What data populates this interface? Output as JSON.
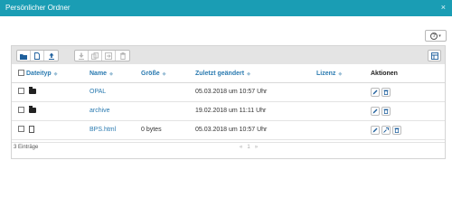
{
  "window": {
    "title": "Persönlicher Ordner",
    "close_glyph": "×"
  },
  "help": {
    "icon": "question-circle-icon",
    "caret": "▾"
  },
  "toolbar": {
    "left_group": [
      "folder-new-icon",
      "file-new-icon",
      "upload-icon"
    ],
    "middle_group": [
      "download-icon",
      "copy-icon",
      "move-icon",
      "delete-icon"
    ],
    "right_button": "settings-table-icon"
  },
  "table": {
    "columns": {
      "type": "Dateityp",
      "name": "Name",
      "size": "Größe",
      "modified": "Zuletzt geändert",
      "license": "Lizenz",
      "actions": "Aktionen"
    },
    "sort_glyph": "◆",
    "rows": [
      {
        "type": "folder",
        "name": "OPAL",
        "size": "",
        "modified": "05.03.2018 um 10:57 Uhr"
      },
      {
        "type": "folder",
        "name": "archive",
        "size": "",
        "modified": "19.02.2018 um 11:11 Uhr"
      },
      {
        "type": "file",
        "name": "BPS.html",
        "size": "0 bytes",
        "modified": "05.03.2018 um 10:57 Uhr"
      }
    ]
  },
  "footer": {
    "count": "3 Einträge",
    "prev": "«",
    "page": "1",
    "next": "»"
  }
}
